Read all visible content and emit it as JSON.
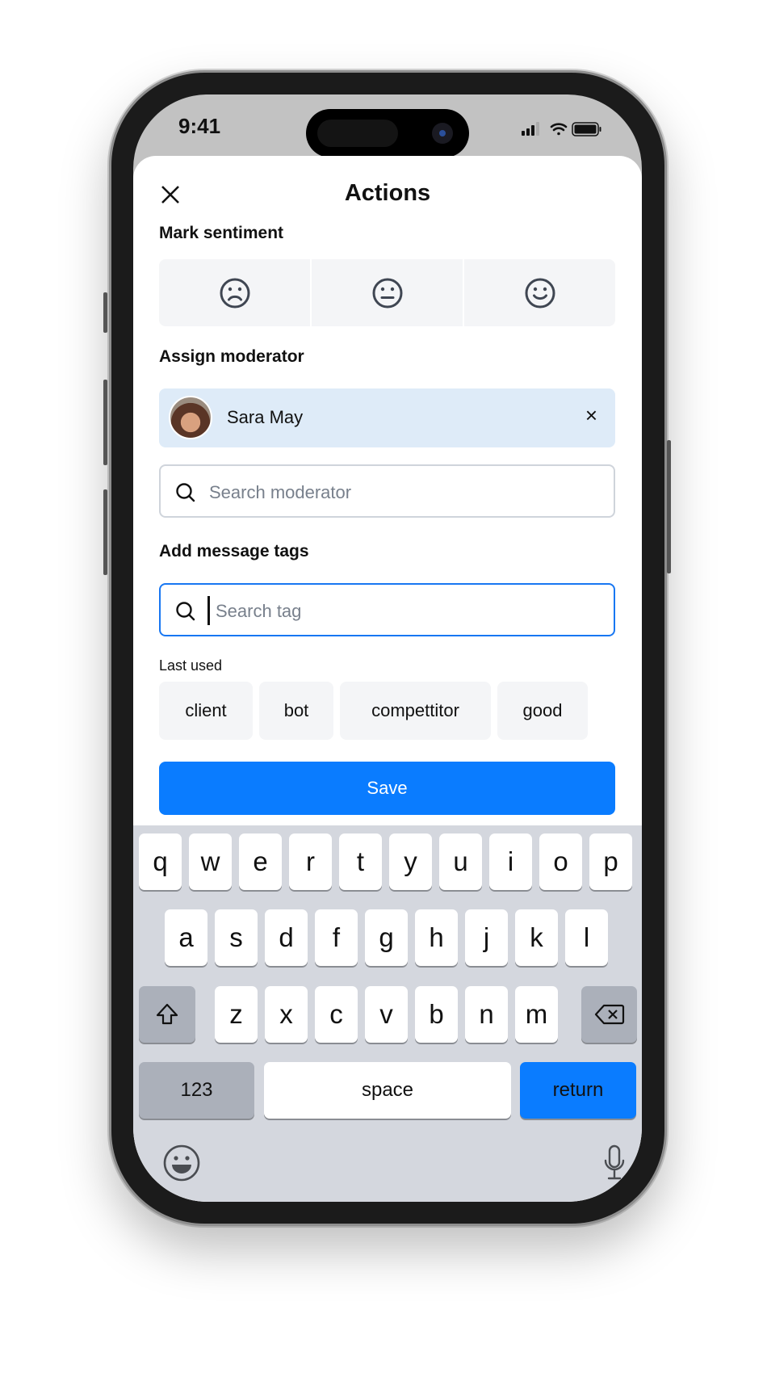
{
  "status_bar": {
    "time": "9:41",
    "icons": [
      "cellular-signal-icon",
      "wifi-icon",
      "battery-icon"
    ]
  },
  "header": {
    "title": "Actions",
    "close_icon": "close-icon"
  },
  "sentiment": {
    "label": "Mark sentiment",
    "options": [
      {
        "name": "negative",
        "icon": "sad-face-icon"
      },
      {
        "name": "neutral",
        "icon": "neutral-face-icon"
      },
      {
        "name": "positive",
        "icon": "happy-face-icon"
      }
    ]
  },
  "moderator": {
    "label": "Assign moderator",
    "selected": {
      "name": "Sara May"
    },
    "remove_label": "×",
    "search_placeholder": "Search moderator"
  },
  "tags": {
    "label": "Add message tags",
    "search_placeholder": "Search tag",
    "search_value": "",
    "last_used_label": "Last used",
    "last_used": [
      "client",
      "bot",
      "compettitor",
      "good"
    ]
  },
  "save_label": "Save",
  "keyboard": {
    "row1": [
      "q",
      "w",
      "e",
      "r",
      "t",
      "y",
      "u",
      "i",
      "o",
      "p"
    ],
    "row2": [
      "a",
      "s",
      "d",
      "f",
      "g",
      "h",
      "j",
      "k",
      "l"
    ],
    "row3": [
      "z",
      "x",
      "c",
      "v",
      "b",
      "n",
      "m"
    ],
    "numbers_label": "123",
    "space_label": "space",
    "return_label": "return"
  },
  "colors": {
    "accent": "#0a7cff",
    "chip_bg": "#deebf8",
    "tag_bg": "#f4f5f7",
    "keyboard_bg": "#d4d7de"
  }
}
